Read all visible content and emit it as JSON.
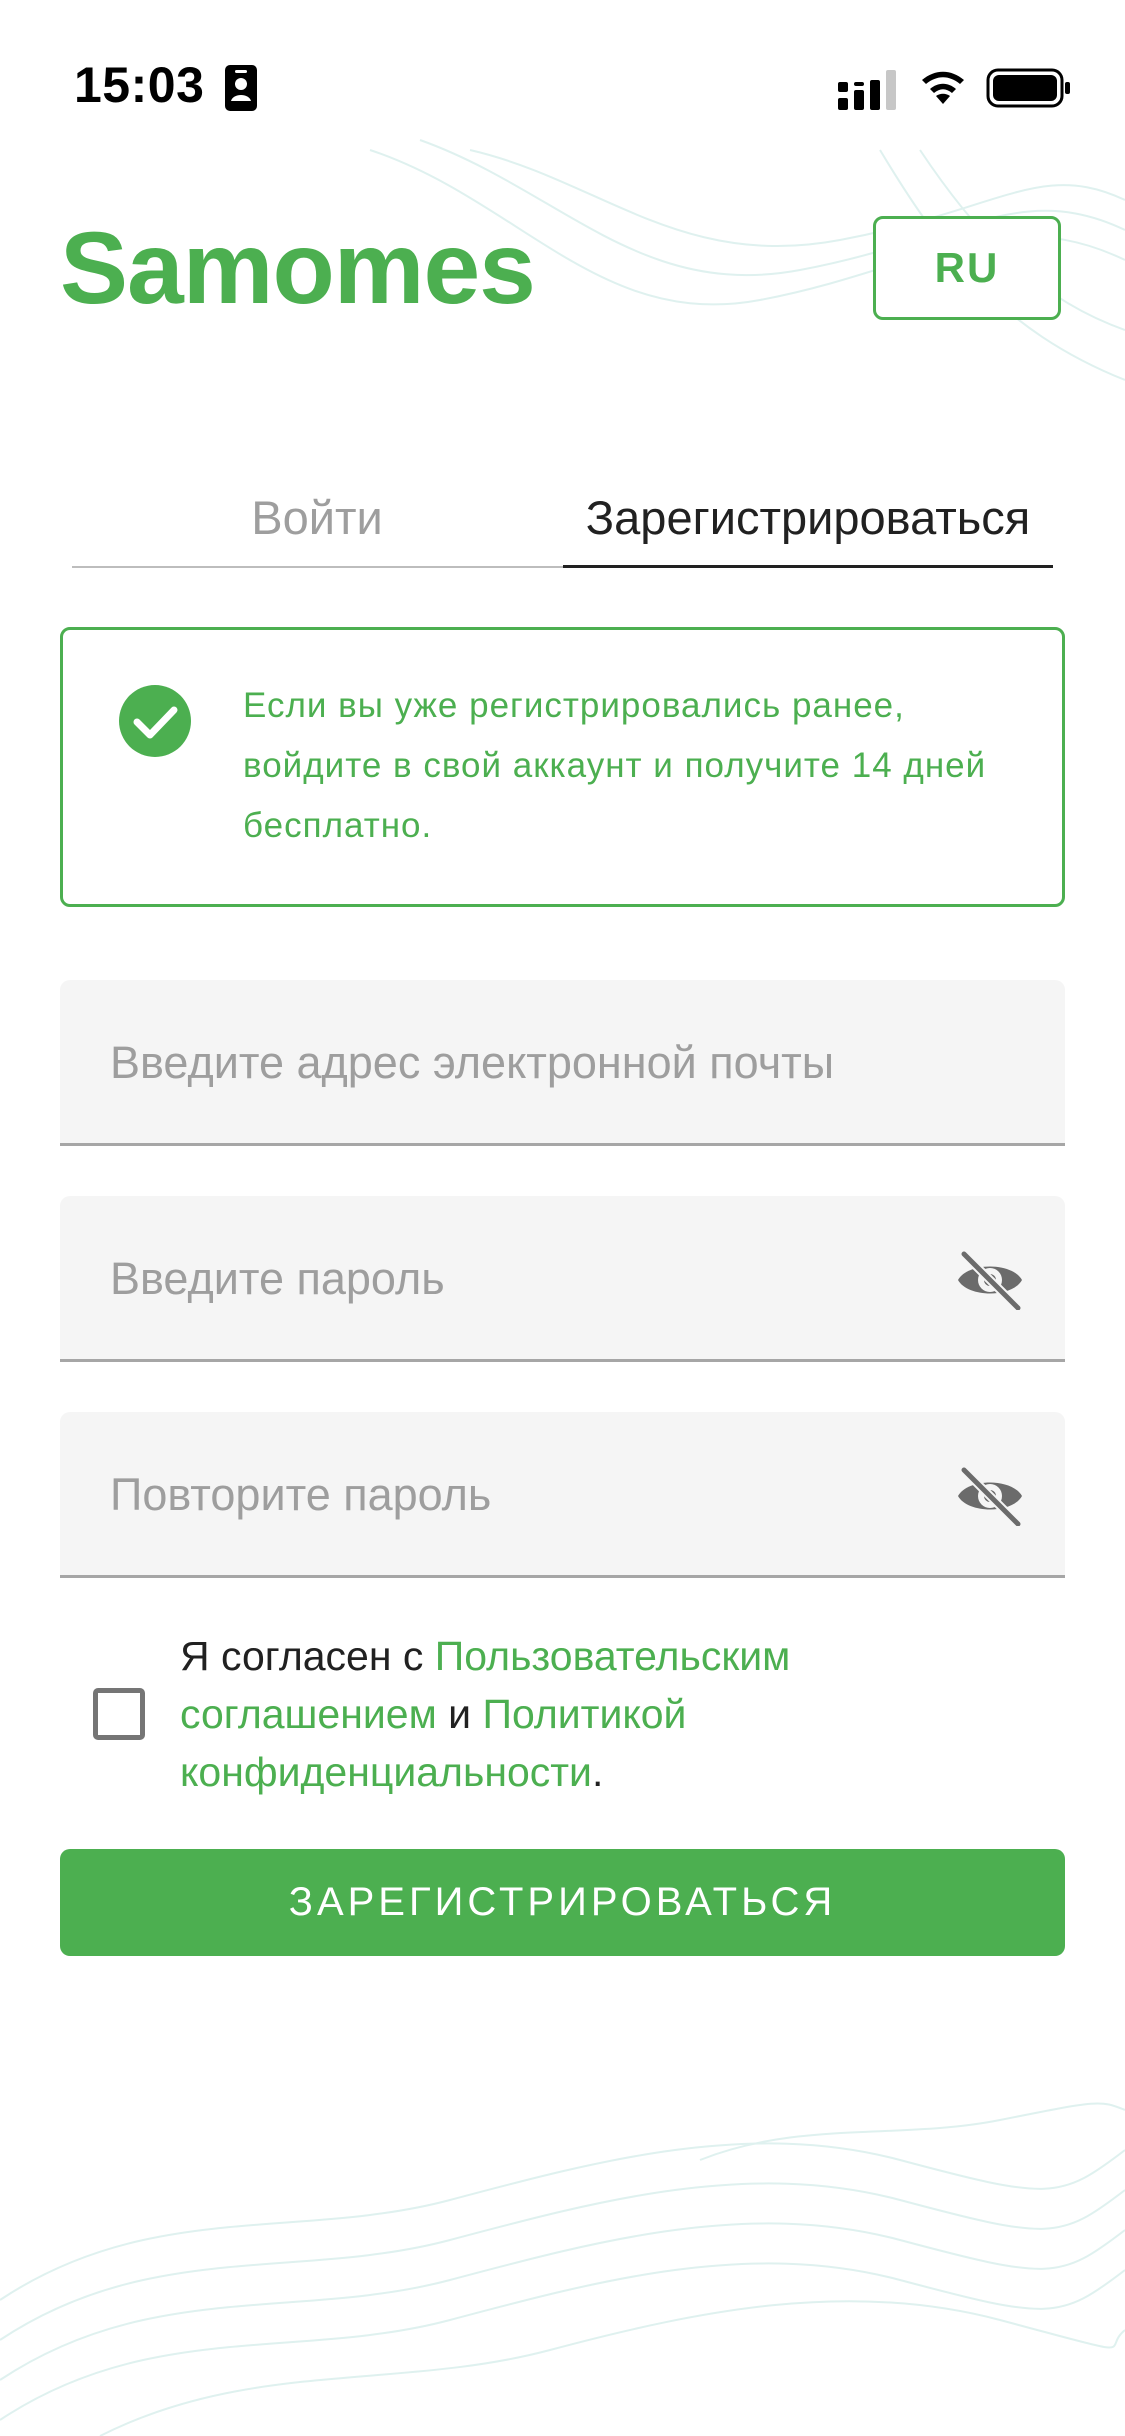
{
  "status_bar": {
    "time": "15:03"
  },
  "header": {
    "logo": "Samomes",
    "language_button": "RU"
  },
  "tabs": [
    {
      "label": "Войти",
      "active": false
    },
    {
      "label": "Зарегистрироваться",
      "active": true
    }
  ],
  "info_box": {
    "text": "Если вы уже регистрировались ранее, войдите в свой аккаунт и получите 14 дней бесплатно."
  },
  "form": {
    "email_placeholder": "Введите адрес электронной почты",
    "email_value": "",
    "password_placeholder": "Введите пароль",
    "password_value": "",
    "repeat_password_placeholder": "Повторите пароль",
    "repeat_password_value": ""
  },
  "agreement": {
    "checked": false,
    "prefix": "Я согласен с ",
    "terms_link": "Пользовательским соглашением",
    "conjunction": " и ",
    "privacy_link": "Политикой конфиденциальности",
    "suffix": "."
  },
  "register_button": "ЗАРЕГИСТРИРОВАТЬСЯ",
  "icons": {
    "status_id": "person-badge-icon",
    "signal": "cellular-signal-icon",
    "wifi": "wifi-icon",
    "battery": "battery-icon",
    "info": "check-circle-icon",
    "password_toggle": "eye-off-icon"
  },
  "colors": {
    "accent": "#4caf50",
    "input_background": "#f5f5f5",
    "placeholder": "#9e9e9e",
    "text": "#212121"
  }
}
